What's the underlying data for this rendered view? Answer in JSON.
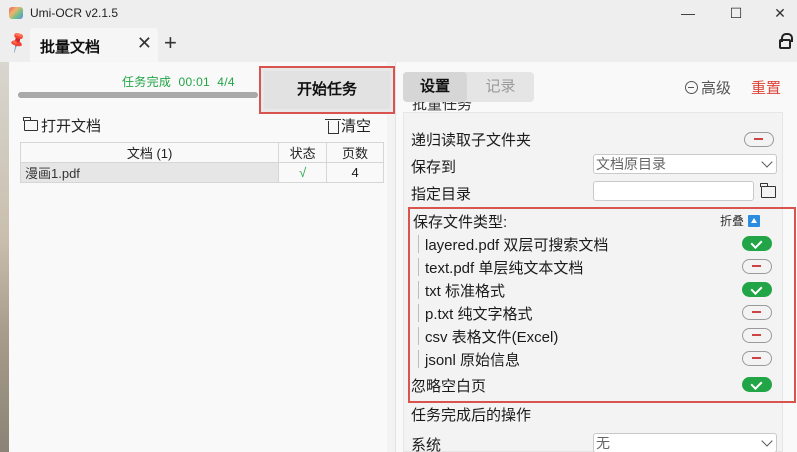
{
  "window": {
    "title": "Umi-OCR v2.1.5",
    "minimize": "—",
    "maximize": "☐",
    "close": "✕"
  },
  "tabs": [
    {
      "label": "批量文档",
      "close": "✕"
    }
  ],
  "tab_add": "+",
  "left": {
    "status_label": "任务完成",
    "elapsed": "00:01",
    "progress_text": "4/4",
    "progress_fraction": 1.0,
    "start_button": "开始任务",
    "open_doc": "打开文档",
    "clear": "清空",
    "table": {
      "headers": [
        "文档 (1)",
        "状态",
        "页数"
      ],
      "rows": [
        {
          "name": "漫画1.pdf",
          "status": "√",
          "pages": "4"
        }
      ]
    }
  },
  "right": {
    "tab_settings": "设置",
    "tab_records": "记录",
    "advanced": "高级",
    "reset": "重置",
    "section_title": "批量任务",
    "recursive_subfolders": {
      "label": "递归读取子文件夹",
      "enabled": false
    },
    "save_to": {
      "label": "保存到",
      "value": "文档原目录"
    },
    "target_dir": {
      "label": "指定目录",
      "value": ""
    },
    "save_types": {
      "label": "保存文件类型:",
      "collapse": "折叠",
      "items": [
        {
          "label": "layered.pdf 双层可搜索文档",
          "enabled": true
        },
        {
          "label": "text.pdf 单层纯文本文档",
          "enabled": false
        },
        {
          "label": "txt 标准格式",
          "enabled": true
        },
        {
          "label": "p.txt 纯文字格式",
          "enabled": false
        },
        {
          "label": "csv 表格文件(Excel)",
          "enabled": false
        },
        {
          "label": "jsonl 原始信息",
          "enabled": false
        }
      ]
    },
    "ignore_blank": {
      "label": "忽略空白页",
      "enabled": true
    },
    "after_task": {
      "label": "任务完成后的操作"
    },
    "system": {
      "label": "系统",
      "value": "无"
    }
  },
  "colors": {
    "accent_green": "#21a546",
    "reset_red": "#e0453a",
    "highlight_red": "#d9534f"
  }
}
